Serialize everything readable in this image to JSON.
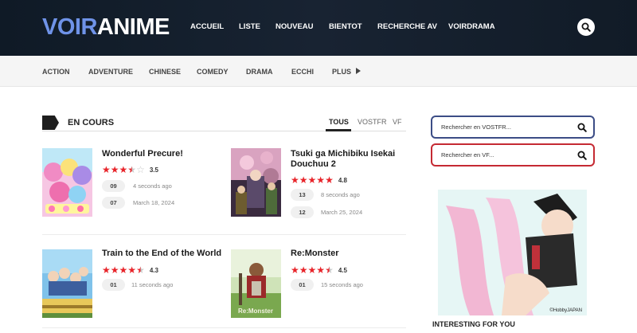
{
  "header": {
    "logo_part1": "VOIR",
    "logo_part2": "ANIME",
    "nav": [
      "ACCUEIL",
      "LISTE",
      "NOUVEAU",
      "BIENTOT",
      "RECHERCHE AV",
      "VOIRDRAMA"
    ],
    "search_icon": "search-icon"
  },
  "genres": [
    "ACTION",
    "ADVENTURE",
    "CHINESE",
    "COMEDY",
    "DRAMA",
    "ECCHI",
    "PLUS"
  ],
  "section": {
    "title": "EN COURS",
    "tabs": [
      "TOUS",
      "VOSTFR",
      "VF"
    ],
    "active_tab": "TOUS"
  },
  "cards": [
    {
      "title": "Wonderful Precure!",
      "rating": "3.5",
      "stars_filled": 3.5,
      "episodes": [
        {
          "num": "09",
          "info": "4 seconds ago"
        },
        {
          "num": "07",
          "info": "March 18, 2024"
        }
      ]
    },
    {
      "title": "Tsuki ga Michibiku Isekai Douchuu 2",
      "rating": "4.8",
      "stars_filled": 5,
      "episodes": [
        {
          "num": "13",
          "info": "8 seconds ago"
        },
        {
          "num": "12",
          "info": "March 25, 2024"
        }
      ]
    },
    {
      "title": "Train to the End of the World",
      "rating": "4.3",
      "stars_filled": 4.5,
      "episodes": [
        {
          "num": "01",
          "info": "11 seconds ago"
        }
      ]
    },
    {
      "title": "Re:Monster",
      "rating": "4.5",
      "stars_filled": 4.5,
      "episodes": [
        {
          "num": "01",
          "info": "15 seconds ago"
        }
      ]
    }
  ],
  "sidebar": {
    "search_vostfr_placeholder": "Rechercher en VOSTFR...",
    "search_vf_placeholder": "Rechercher en VF...",
    "ad_credit": "©HobbyJAPAN",
    "interesting_title": "INTERESTING FOR YOU"
  },
  "colors": {
    "logo_accent": "#6f93e8",
    "star": "#e8242a",
    "vostfr_border": "#3c4d86",
    "vf_border": "#c52a33"
  }
}
